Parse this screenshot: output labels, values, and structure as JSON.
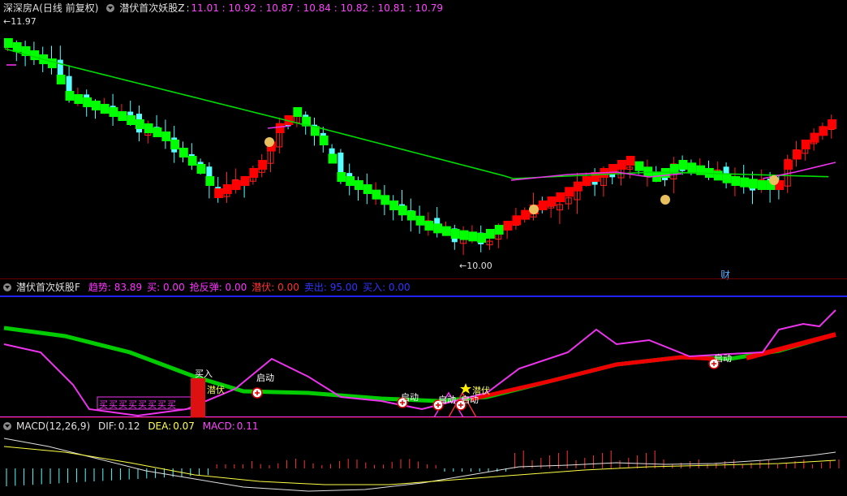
{
  "main_panel": {
    "stock_name": "深深房A",
    "period": "(日线 前复权)",
    "indicator_name": "潜伏首次妖股Z",
    "values": [
      "11.01",
      "10.92",
      "10.87",
      "10.84",
      "10.82",
      "10.81",
      "10.79"
    ],
    "high_marker": "11.97",
    "low_marker": "10.00",
    "finance_label": "财",
    "colors": {
      "up": "#ff2020",
      "down": "#55ffff",
      "signal_up": "#ff0000",
      "signal_down": "#00ff00",
      "ma_green": "#00dd00",
      "ma_magenta": "#ee33ee"
    }
  },
  "sub_panel_f": {
    "indicator_name": "潜伏首次妖股F",
    "fields": [
      {
        "label": "趋势:",
        "value": "83.89",
        "color": "#ff33ff"
      },
      {
        "label": "买:",
        "value": "0.00",
        "color": "#ff33ff"
      },
      {
        "label": "抢反弹:",
        "value": "0.00",
        "color": "#ff33ff"
      },
      {
        "label": "潜伏:",
        "value": "0.00",
        "color": "#ff3333"
      },
      {
        "label": "卖出:",
        "value": "95.00",
        "color": "#3333ff"
      },
      {
        "label": "买入:",
        "value": "0.00",
        "color": "#3333ff"
      }
    ],
    "labels": {
      "buy": "买入",
      "latent": "潜伏",
      "start": "启动",
      "buy_row": "买买买买买买买买"
    }
  },
  "sub_panel_macd": {
    "indicator_name": "MACD(12,26,9)",
    "dif_label": "DIF:",
    "dif_value": "0.12",
    "dea_label": "DEA:",
    "dea_value": "0.07",
    "macd_label": "MACD:",
    "macd_value": "0.11"
  }
}
